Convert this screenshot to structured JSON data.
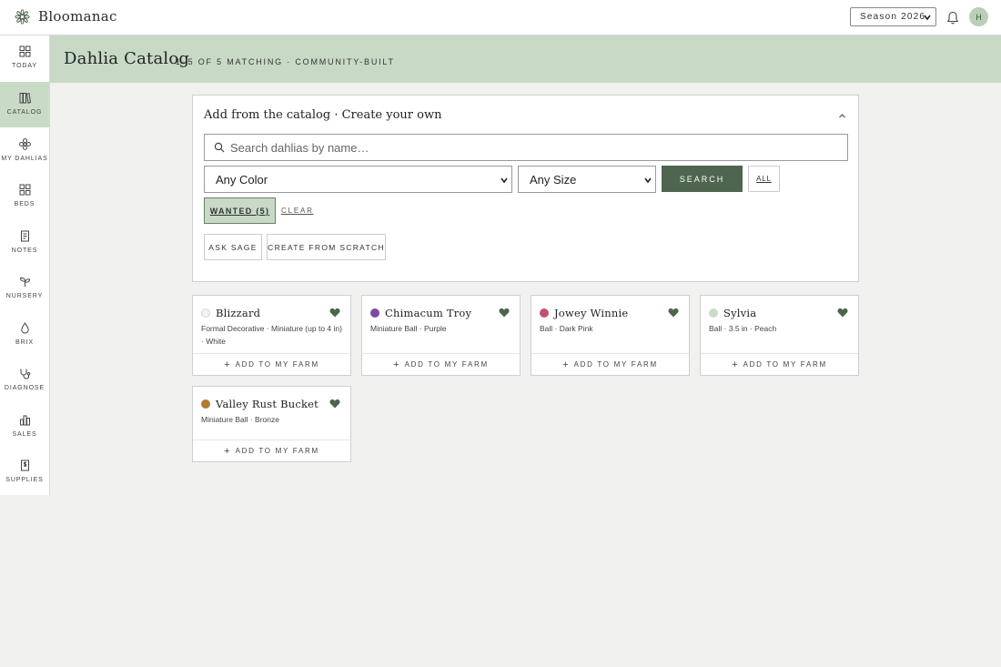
{
  "header": {
    "brand": "Bloomanac",
    "season_selected": "Season 2026",
    "avatar_initial": "H"
  },
  "sidebar": {
    "items": [
      {
        "label": "TODAY",
        "icon": "grid-icon",
        "active": false
      },
      {
        "label": "CATALOG",
        "icon": "books-icon",
        "active": true
      },
      {
        "label": "MY DAHLIAS",
        "icon": "flower-icon",
        "active": false
      },
      {
        "label": "BEDS",
        "icon": "grid-icon",
        "active": false
      },
      {
        "label": "NOTES",
        "icon": "note-icon",
        "active": false
      },
      {
        "label": "NURSERY",
        "icon": "sprout-icon",
        "active": false
      },
      {
        "label": "BRIX",
        "icon": "drop-icon",
        "active": false
      },
      {
        "label": "DIAGNOSE",
        "icon": "stethoscope-icon",
        "active": false
      },
      {
        "label": "SALES",
        "icon": "bar-chart-icon",
        "active": false
      },
      {
        "label": "SUPPLIES",
        "icon": "receipt-icon",
        "active": false
      }
    ]
  },
  "page": {
    "title": "Dahlia Catalog",
    "subtitle": "1–5 OF 5 MATCHING · COMMUNITY-BUILT"
  },
  "panel": {
    "title": "Add from the catalog · Create your own",
    "search_placeholder": "Search dahlias by name…",
    "color_select": "Any Color",
    "size_select": "Any Size",
    "search_label": "SEARCH",
    "all_label": "ALL",
    "wanted_label": "WANTED (5)",
    "clear_label": "CLEAR",
    "ask_sage_label": "ASK SAGE",
    "create_label": "CREATE FROM SCRATCH"
  },
  "cards": [
    {
      "name": "Blizzard",
      "desc": "Formal Decorative · Miniature (up to 4 in) · White",
      "color": "#f2f2ee",
      "add_label": "ADD TO MY FARM"
    },
    {
      "name": "Chimacum Troy",
      "desc": "Miniature Ball · Purple",
      "color": "#7b4aa8",
      "add_label": "ADD TO MY FARM"
    },
    {
      "name": "Jowey Winnie",
      "desc": "Ball · Dark Pink",
      "color": "#c4506e",
      "add_label": "ADD TO MY FARM"
    },
    {
      "name": "Sylvia",
      "desc": "Ball · 3.5 in · Peach",
      "color": "#c8dcc4",
      "add_label": "ADD TO MY FARM"
    },
    {
      "name": "Valley Rust Bucket",
      "desc": "Miniature Ball · Bronze",
      "color": "#b07a34",
      "add_label": "ADD TO MY FARM"
    }
  ],
  "colors": {
    "accent": "#4f6550",
    "banner": "#c8dac6",
    "heart": "#4e644f"
  }
}
